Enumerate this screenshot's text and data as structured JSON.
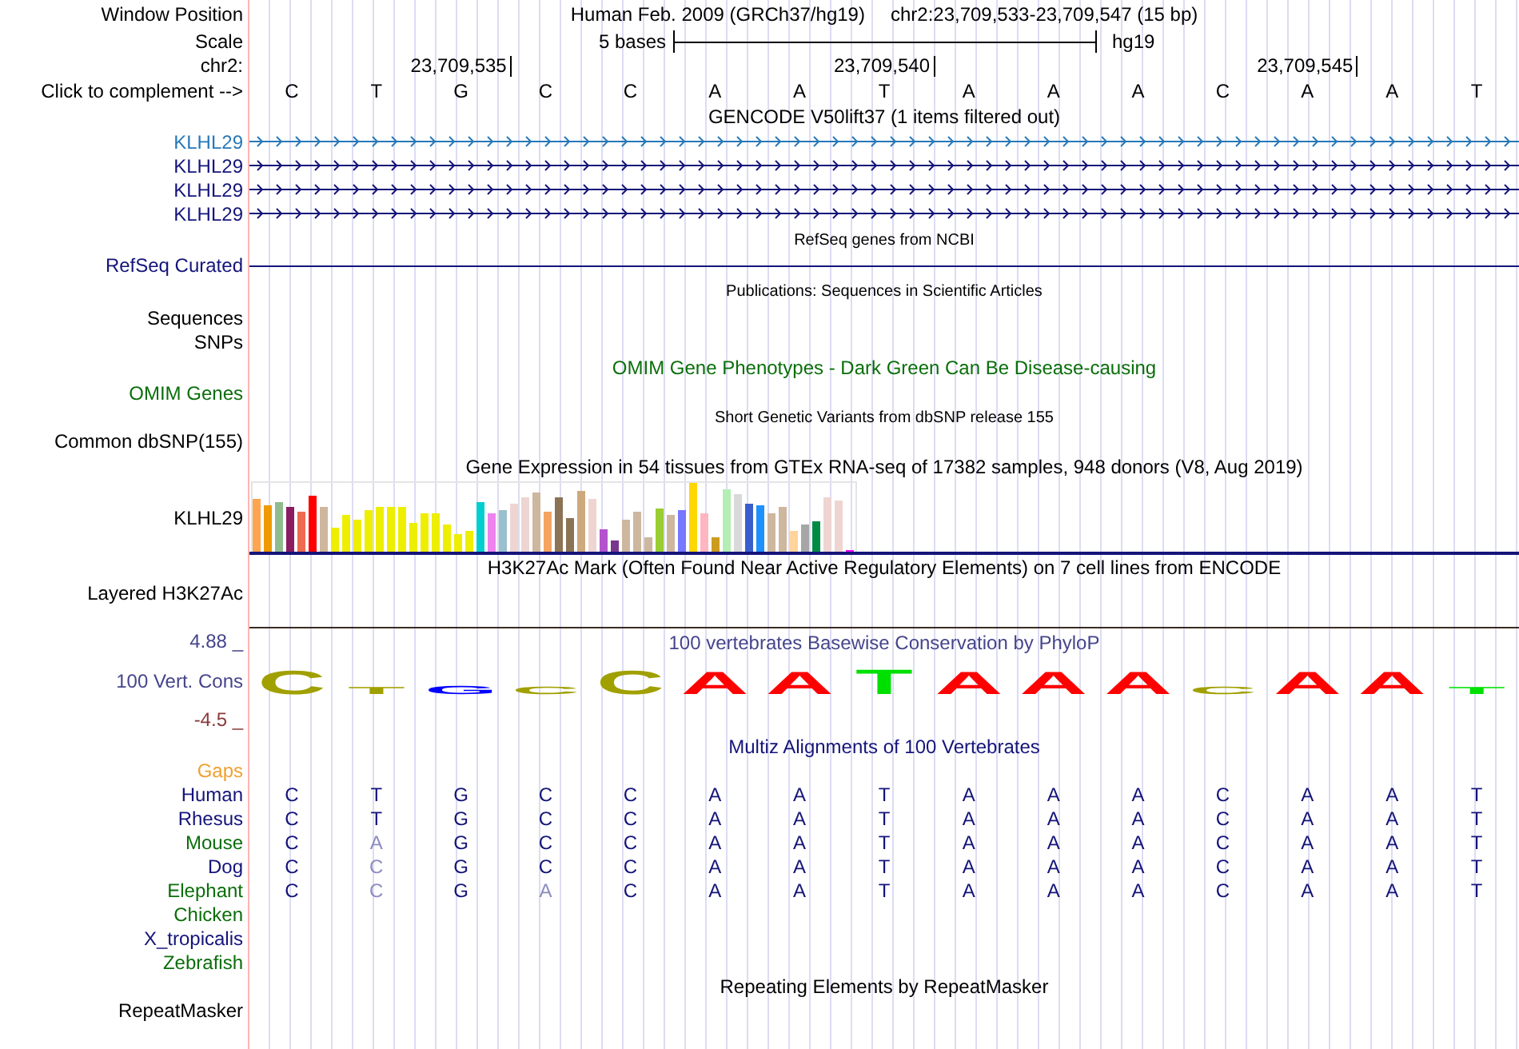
{
  "header": {
    "position_label": "Window Position",
    "assembly": "Human Feb. 2009 (GRCh37/hg19)",
    "position": "chr2:23,709,533-23,709,547 (15 bp)",
    "scale_label": "Scale",
    "scale": "5 bases",
    "scale_db": "hg19",
    "chrom_label": "chr2:",
    "complement_label": "Click to complement -->"
  },
  "bases": [
    {
      "base": "C"
    },
    {
      "base": "T"
    },
    {
      "base": "G",
      "coordinate": "23,709,535"
    },
    {
      "base": "C"
    },
    {
      "base": "C"
    },
    {
      "base": "A"
    },
    {
      "base": "A"
    },
    {
      "base": "T",
      "coordinate": "23,709,540"
    },
    {
      "base": "A"
    },
    {
      "base": "A"
    },
    {
      "base": "A"
    },
    {
      "base": "C"
    },
    {
      "base": "A",
      "coordinate": "23,709,545"
    },
    {
      "base": "A"
    },
    {
      "base": "T"
    }
  ],
  "gencode": {
    "title": "GENCODE V50lift37 (1 items filtered out)",
    "genes": [
      {
        "name": "KLHL29",
        "color": "#2878b8"
      },
      {
        "name": "KLHL29",
        "color": "#14147a"
      },
      {
        "name": "KLHL29",
        "color": "#14147a"
      },
      {
        "name": "KLHL29",
        "color": "#14147a"
      }
    ]
  },
  "refseq": {
    "title": "RefSeq genes from NCBI",
    "label": "RefSeq Curated"
  },
  "publications": {
    "title": "Publications: Sequences in Scientific Articles",
    "labels": [
      "Sequences",
      "SNPs"
    ]
  },
  "omim": {
    "title": "OMIM Gene Phenotypes - Dark Green Can Be Disease-causing",
    "label": "OMIM Genes"
  },
  "dbsnp": {
    "title": "Short Genetic Variants from dbSNP release 155",
    "label": "Common dbSNP(155)"
  },
  "gtex": {
    "title": "Gene Expression in 54 tissues from GTEx RNA-seq of 17382 samples, 948 donors (V8, Aug 2019)",
    "label": "KLHL29"
  },
  "h3k27ac": {
    "title": "H3K27Ac Mark (Often Found Near Active Regulatory Elements) on 7 cell lines from ENCODE",
    "label": "Layered H3K27Ac"
  },
  "phylop": {
    "title": "100 vertebrates Basewise Conservation by PhyloP",
    "label": "100 Vert. Cons",
    "max": "4.88 _",
    "min": "-4.5 _",
    "logo": [
      {
        "letter": "C",
        "color": "#a0a000"
      },
      {
        "letter": "T",
        "color": "#a0a000"
      },
      {
        "letter": "G",
        "color": "#0000ff"
      },
      {
        "letter": "C",
        "color": "#a0a000"
      },
      {
        "letter": "C",
        "color": "#a0a000"
      },
      {
        "letter": "A",
        "color": "#ff0000"
      },
      {
        "letter": "A",
        "color": "#ff0000"
      },
      {
        "letter": "T",
        "color": "#00e000"
      },
      {
        "letter": "A",
        "color": "#ff0000"
      },
      {
        "letter": "A",
        "color": "#ff0000"
      },
      {
        "letter": "A",
        "color": "#ff0000"
      },
      {
        "letter": "C",
        "color": "#a0a000"
      },
      {
        "letter": "A",
        "color": "#ff0000"
      },
      {
        "letter": "A",
        "color": "#ff0000"
      },
      {
        "letter": "T",
        "color": "#00e000"
      }
    ]
  },
  "multiz": {
    "title": "Multiz Alignments of 100 Vertebrates",
    "gaps_label": "Gaps",
    "species": [
      {
        "name": "Human",
        "color": "#14147a",
        "bases": [
          "C",
          "T",
          "G",
          "C",
          "C",
          "A",
          "A",
          "T",
          "A",
          "A",
          "A",
          "C",
          "A",
          "A",
          "T"
        ]
      },
      {
        "name": "Rhesus",
        "color": "#14147a",
        "bases": [
          "C",
          "T",
          "G",
          "C",
          "C",
          "A",
          "A",
          "T",
          "A",
          "A",
          "A",
          "C",
          "A",
          "A",
          "T"
        ]
      },
      {
        "name": "Mouse",
        "color": "#0a6e0a",
        "bases": [
          "C",
          "A",
          "G",
          "C",
          "C",
          "A",
          "A",
          "T",
          "A",
          "A",
          "A",
          "C",
          "A",
          "A",
          "T"
        ]
      },
      {
        "name": "Dog",
        "color": "#14147a",
        "bases": [
          "C",
          "C",
          "G",
          "C",
          "C",
          "A",
          "A",
          "T",
          "A",
          "A",
          "A",
          "C",
          "A",
          "A",
          "T"
        ]
      },
      {
        "name": "Elephant",
        "color": "#0a6e0a",
        "bases": [
          "C",
          "C",
          "G",
          "A",
          "C",
          "A",
          "A",
          "T",
          "A",
          "A",
          "A",
          "C",
          "A",
          "A",
          "T"
        ]
      },
      {
        "name": "Chicken",
        "color": "#0a6e0a"
      },
      {
        "name": "X_tropicalis",
        "color": "#14147a"
      },
      {
        "name": "Zebrafish",
        "color": "#0a6e0a"
      }
    ]
  },
  "repeatmasker": {
    "title": "Repeating Elements by RepeatMasker",
    "label": "RepeatMasker"
  }
}
